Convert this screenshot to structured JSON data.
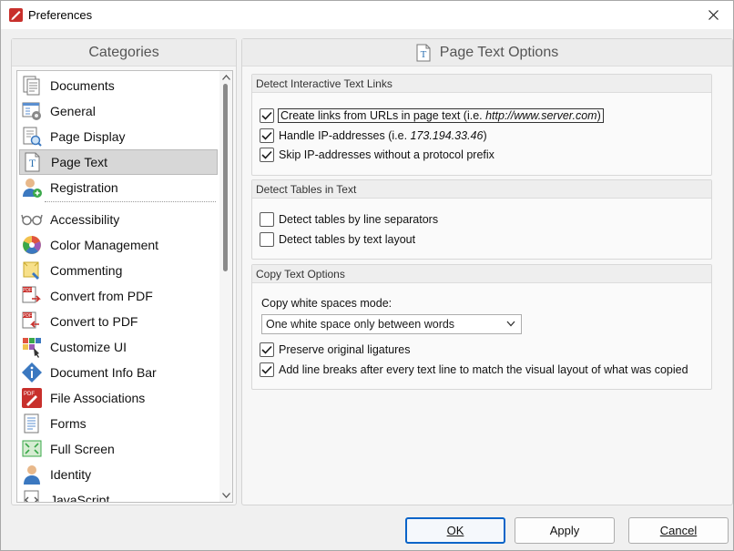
{
  "window": {
    "title": "Preferences"
  },
  "categories": {
    "header": "Categories",
    "items": [
      {
        "label": "Documents",
        "icon": "documents-icon"
      },
      {
        "label": "General",
        "icon": "general-icon"
      },
      {
        "label": "Page Display",
        "icon": "page-display-icon"
      },
      {
        "label": "Page Text",
        "icon": "page-text-icon",
        "selected": true
      },
      {
        "label": "Registration",
        "icon": "registration-icon"
      },
      {
        "label": "Accessibility",
        "icon": "accessibility-icon"
      },
      {
        "label": "Color Management",
        "icon": "color-management-icon"
      },
      {
        "label": "Commenting",
        "icon": "commenting-icon"
      },
      {
        "label": "Convert from PDF",
        "icon": "convert-from-pdf-icon"
      },
      {
        "label": "Convert to PDF",
        "icon": "convert-to-pdf-icon"
      },
      {
        "label": "Customize UI",
        "icon": "customize-ui-icon"
      },
      {
        "label": "Document Info Bar",
        "icon": "document-info-bar-icon"
      },
      {
        "label": "File Associations",
        "icon": "file-associations-icon"
      },
      {
        "label": "Forms",
        "icon": "forms-icon"
      },
      {
        "label": "Full Screen",
        "icon": "full-screen-icon"
      },
      {
        "label": "Identity",
        "icon": "identity-icon"
      },
      {
        "label": "JavaScript",
        "icon": "javascript-icon"
      }
    ]
  },
  "options": {
    "header": "Page Text Options",
    "links": {
      "title": "Detect Interactive Text Links",
      "create_links_prefix": "Create links from URLs in page text (i.e. ",
      "create_links_example": "http://www.server.com",
      "create_links_suffix": ")",
      "handle_ip_prefix": "Handle IP-addresses (i.e. ",
      "handle_ip_example": "173.194.33.46",
      "handle_ip_suffix": ")",
      "skip_ip": "Skip IP-addresses without a protocol prefix",
      "create_links_checked": true,
      "handle_ip_checked": true,
      "skip_ip_checked": true
    },
    "tables": {
      "title": "Detect Tables in Text",
      "by_separators": "Detect tables by line separators",
      "by_layout": "Detect tables by text layout",
      "by_separators_checked": false,
      "by_layout_checked": false
    },
    "copy": {
      "title": "Copy Text Options",
      "whitespace_label": "Copy white spaces mode:",
      "whitespace_value": "One white space only between words",
      "preserve_ligatures": "Preserve original ligatures",
      "add_line_breaks": "Add line breaks after every text line to match the visual layout of what was copied",
      "preserve_ligatures_checked": true,
      "add_line_breaks_checked": true
    }
  },
  "buttons": {
    "ok": "OK",
    "apply": "Apply",
    "cancel": "Cancel"
  },
  "colors": {
    "accent": "#0a64c8",
    "selection": "#d7d7d7",
    "pdf_red": "#c8302c"
  }
}
